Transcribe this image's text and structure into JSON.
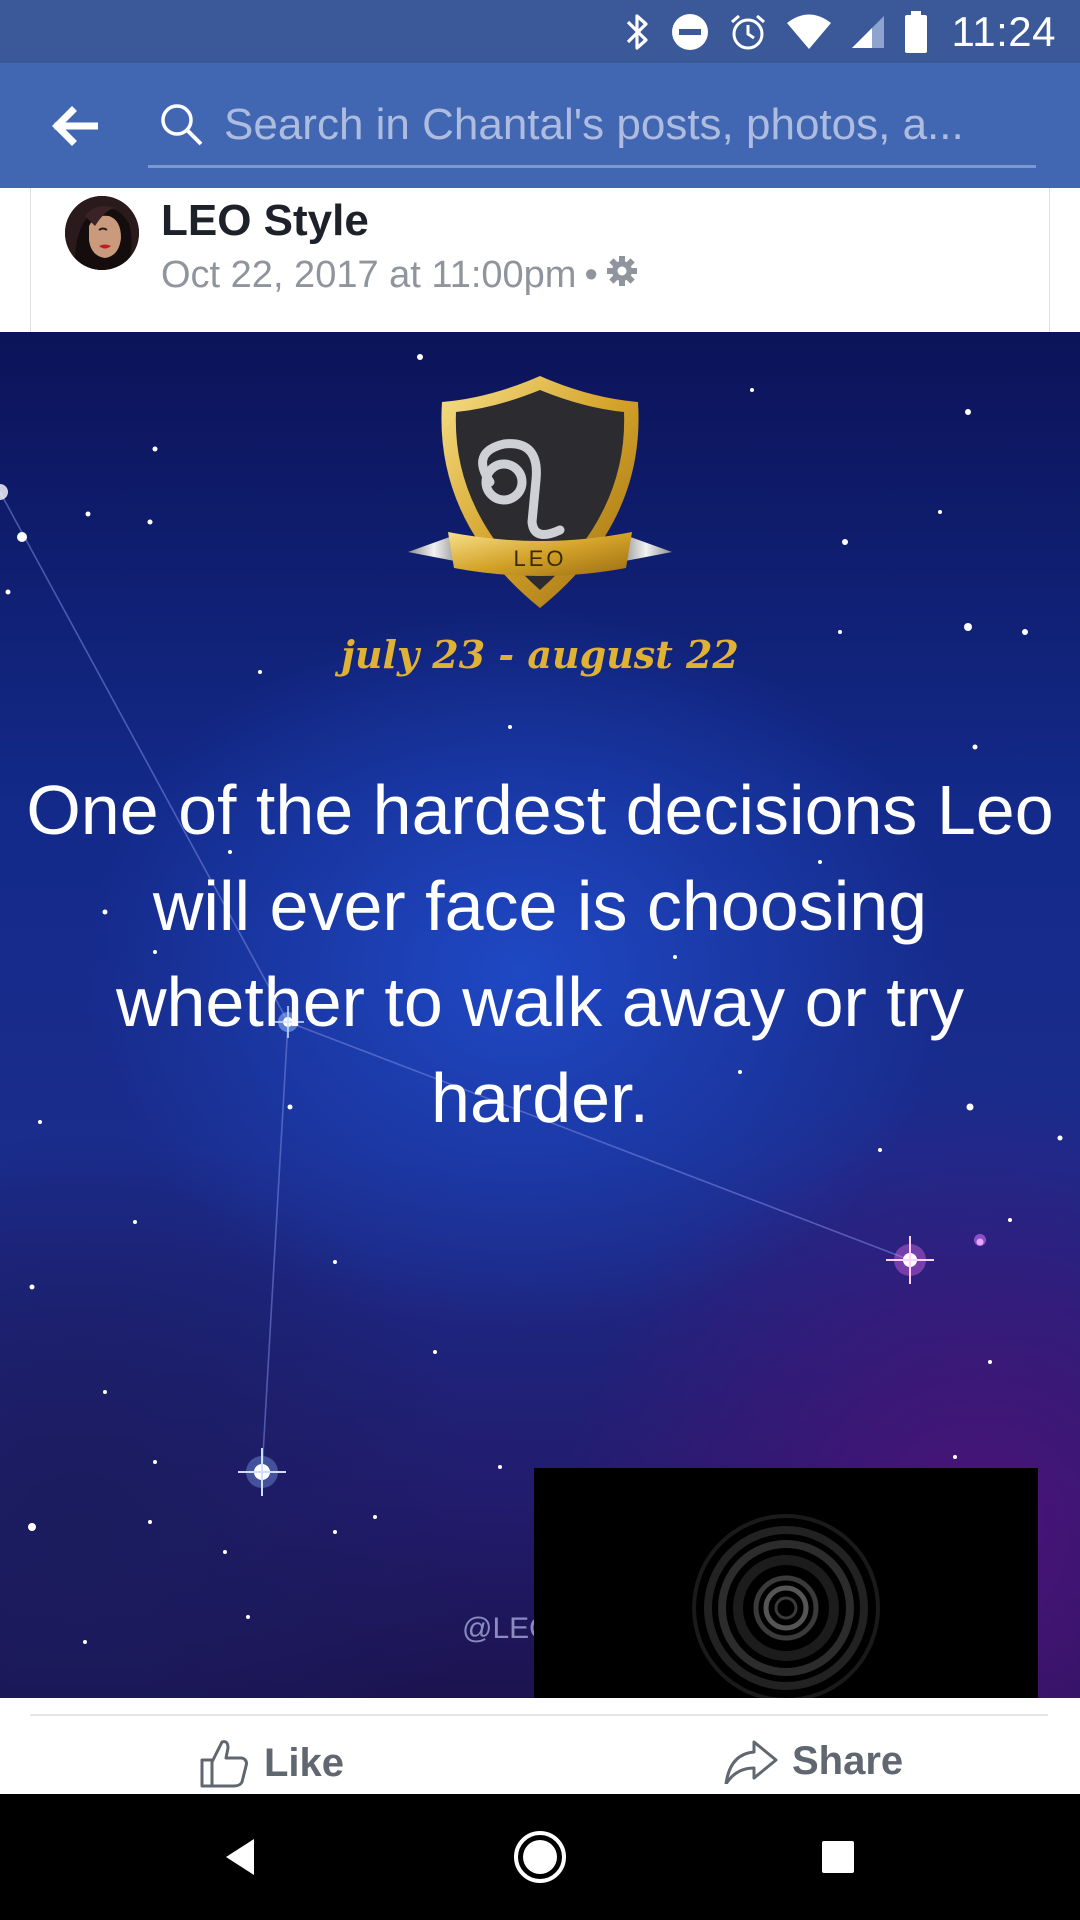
{
  "status_bar": {
    "time": "11:24",
    "icons": [
      "bluetooth-icon",
      "do-not-disturb-icon",
      "alarm-icon",
      "wifi-icon",
      "signal-icon",
      "battery-icon"
    ]
  },
  "app_bar": {
    "back_icon": "arrow-left-icon",
    "search_placeholder": "Search in Chantal's posts, photos, a..."
  },
  "post": {
    "author": "LEO Style",
    "timestamp": "Oct 22, 2017 at 11:00pm",
    "separator": "•",
    "privacy_icon": "gear-icon",
    "image": {
      "badge_label": "LEO",
      "date_range": "july 23 - august 22",
      "quote": "One of the hardest decisions Leo will ever face is choosing whether to walk away or try harder.",
      "watermark": "@LEO"
    }
  },
  "actions": {
    "like_label": "Like",
    "share_label": "Share"
  },
  "nav_bar": {
    "icons": [
      "back-triangle-icon",
      "home-circle-icon",
      "recents-square-icon"
    ]
  },
  "colors": {
    "status_bar": "#3b5998",
    "app_bar": "#4267b2",
    "badge_gold": "#e0b233",
    "action_text": "#606770"
  }
}
